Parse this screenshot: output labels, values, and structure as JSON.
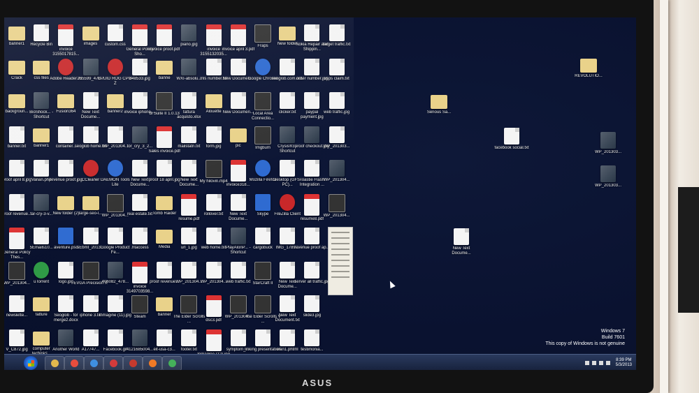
{
  "desktop": {
    "icons": [
      {
        "label": "banner1",
        "kind": "folder"
      },
      {
        "label": "Recycle Bin",
        "kind": "doc"
      },
      {
        "label": "invoice 3155017815...",
        "kind": "pdf"
      },
      {
        "label": "images",
        "kind": "folder"
      },
      {
        "label": "custom.css",
        "kind": "doc"
      },
      {
        "label": "General Policy Sho...",
        "kind": "pdf"
      },
      {
        "label": "invoice proof.pdf",
        "kind": "pdf"
      },
      {
        "label": "piano.jpg",
        "kind": "img"
      },
      {
        "label": "invoice 3155132035...",
        "kind": "pdf"
      },
      {
        "label": "invoice april 3.pdf",
        "kind": "pdf"
      },
      {
        "label": "Fraps",
        "kind": "dark"
      },
      {
        "label": "New folder",
        "kind": "folder"
      },
      {
        "label": "Nokia Repair and Shippin...",
        "kind": "doc"
      },
      {
        "label": "target traffic.txt",
        "kind": "doc"
      },
      {
        "label": "Crack",
        "kind": "folder"
      },
      {
        "label": "css files",
        "kind": "folder"
      },
      {
        "label": "Adobe Reader XI",
        "kind": "red"
      },
      {
        "label": "255599_478...",
        "kind": "img"
      },
      {
        "label": "CPUID ROG CPU-Z",
        "kind": "red"
      },
      {
        "label": "848533.jpg",
        "kind": "doc"
      },
      {
        "label": "banne",
        "kind": "folder"
      },
      {
        "label": "WXI-absolu...",
        "kind": "img"
      },
      {
        "label": "mls number.txt",
        "kind": "doc"
      },
      {
        "label": "New Documen...",
        "kind": "doc"
      },
      {
        "label": "Google Chrome",
        "kind": "round"
      },
      {
        "label": "seoglob.com.odv",
        "kind": "doc"
      },
      {
        "label": "order number.jpg",
        "kind": "doc"
      },
      {
        "label": "usps claim.txt",
        "kind": "doc"
      },
      {
        "label": "backgroun...",
        "kind": "folder"
      },
      {
        "label": "BioShock... - Shortcut",
        "kind": "img"
      },
      {
        "label": "Fusion364",
        "kind": "folder"
      },
      {
        "label": "New Text Docume...",
        "kind": "doc"
      },
      {
        "label": "banner2",
        "kind": "folder"
      },
      {
        "label": "invoice iphone ...",
        "kind": "doc"
      },
      {
        "label": "dl Suite II 1.0.13",
        "kind": "dark"
      },
      {
        "label": "fattura acquisto.xlsx",
        "kind": "doc"
      },
      {
        "label": "Alouette",
        "kind": "folder"
      },
      {
        "label": "New Documen...",
        "kind": "doc"
      },
      {
        "label": "Local Area Connectio...",
        "kind": "dark"
      },
      {
        "label": "clicker.txt",
        "kind": "doc"
      },
      {
        "label": "paypal payment.jpg",
        "kind": "doc"
      },
      {
        "label": "web traffic.jpg",
        "kind": "doc"
      },
      {
        "label": "banner.txt",
        "kind": "doc"
      },
      {
        "label": "banner1",
        "kind": "folder"
      },
      {
        "label": "container...",
        "kind": "doc"
      },
      {
        "label": "seoglob home.txt",
        "kind": "doc"
      },
      {
        "label": "WP_201304...",
        "kind": "doc"
      },
      {
        "label": "for_cry_3_2...",
        "kind": "img"
      },
      {
        "label": "Sales invoice.pdf",
        "kind": "pdf"
      },
      {
        "label": "mailstatri.txt",
        "kind": "doc"
      },
      {
        "label": "form.jpg",
        "kind": "doc"
      },
      {
        "label": "pic",
        "kind": "folder"
      },
      {
        "label": "Imgbum",
        "kind": "dark"
      },
      {
        "label": "Crysis®3 - Shortcut",
        "kind": "img"
      },
      {
        "label": "proof checkout.jpg",
        "kind": "img"
      },
      {
        "label": "WP_201303...",
        "kind": "doc"
      },
      {
        "label": "proof april 8.jpg",
        "kind": "doc"
      },
      {
        "label": "Varian.php",
        "kind": "doc"
      },
      {
        "label": "revenue proof.jpg",
        "kind": "doc"
      },
      {
        "label": "CCleaner",
        "kind": "red"
      },
      {
        "label": "DAEMON Tools Lite",
        "kind": "round"
      },
      {
        "label": "New Text Docume...",
        "kind": "doc"
      },
      {
        "label": "proof 18 april.jpg",
        "kind": "doc"
      },
      {
        "label": "New Text Docume...",
        "kind": "doc"
      },
      {
        "label": "My hilovin.mp4",
        "kind": "dark"
      },
      {
        "label": "invoice318...",
        "kind": "pdf"
      },
      {
        "label": "Mozilla Firefox",
        "kind": "round"
      },
      {
        "label": "Desktop (GFS-PC)...",
        "kind": "doc"
      },
      {
        "label": "Toastie Flash Integration ...",
        "kind": "doc"
      },
      {
        "label": "WP_201304...",
        "kind": "img"
      },
      {
        "label": "proof revenue...",
        "kind": "doc"
      },
      {
        "label": "far-cry-3-v...",
        "kind": "img"
      },
      {
        "label": "New folder (2)",
        "kind": "folder"
      },
      {
        "label": "large-seo-l...",
        "kind": "folder"
      },
      {
        "label": "WP_201304...",
        "kind": "dark"
      },
      {
        "label": "real estate.txt",
        "kind": "doc"
      },
      {
        "label": "Tomb Raider",
        "kind": "folder"
      },
      {
        "label": "resume.pdf",
        "kind": "pdf"
      },
      {
        "label": "rollover.txt",
        "kind": "doc"
      },
      {
        "label": "New Text Docume...",
        "kind": "doc"
      },
      {
        "label": "Skype",
        "kind": "blue"
      },
      {
        "label": "FileZilla Client",
        "kind": "red"
      },
      {
        "label": "resume8.pdf",
        "kind": "pdf"
      },
      {
        "label": "WP_201304...",
        "kind": "dark"
      },
      {
        "label": "General Policy Thes...",
        "kind": "pdf"
      },
      {
        "label": "5Emails10...",
        "kind": "doc"
      },
      {
        "label": "aventure.psd",
        "kind": "blue"
      },
      {
        "label": "sEbmt_2013...",
        "kind": "doc"
      },
      {
        "label": "Google Product Fe...",
        "kind": "doc"
      },
      {
        "label": ".htaccess",
        "kind": "doc"
      },
      {
        "label": "Media",
        "kind": "folder"
      },
      {
        "label": "url_1.jpg",
        "kind": "doc"
      },
      {
        "label": "web home.txt",
        "kind": "doc"
      },
      {
        "label": "PlayAlonP... - Shortcut",
        "kind": "img"
      },
      {
        "label": "cargobuck",
        "kind": "doc"
      },
      {
        "label": "IMG_1789...",
        "kind": "doc"
      },
      {
        "label": "revenue proof ap...",
        "kind": "doc"
      },
      {
        "label": "",
        "kind": "none"
      },
      {
        "label": "WP_201304...",
        "kind": "dark"
      },
      {
        "label": "uTorrent",
        "kind": "green"
      },
      {
        "label": "logo.jpg",
        "kind": "doc"
      },
      {
        "label": "EVGA Precision X",
        "kind": "dark"
      },
      {
        "label": "406082_478...",
        "kind": "img"
      },
      {
        "label": "invoice 3149703598...",
        "kind": "pdf"
      },
      {
        "label": "proof revenue...",
        "kind": "doc"
      },
      {
        "label": "WP_201304...",
        "kind": "doc"
      },
      {
        "label": "WP_201304...",
        "kind": "doc"
      },
      {
        "label": "web traffic.txt",
        "kind": "doc"
      },
      {
        "label": "StarCraft II",
        "kind": "dark"
      },
      {
        "label": "New Text Docume...",
        "kind": "doc"
      },
      {
        "label": "server all traffic.jpg",
        "kind": "doc"
      },
      {
        "label": "",
        "kind": "none"
      },
      {
        "label": "newslette...",
        "kind": "doc"
      },
      {
        "label": "fatture",
        "kind": "folder"
      },
      {
        "label": "Seoglob - for merge2.docx",
        "kind": "doc"
      },
      {
        "label": "iphone 3.txt",
        "kind": "doc"
      },
      {
        "label": "Inmagine (11).jpg",
        "kind": "doc"
      },
      {
        "label": "Steam",
        "kind": "dark"
      },
      {
        "label": "banner",
        "kind": "folder"
      },
      {
        "label": "The Elder Scrolls ...",
        "kind": "dark"
      },
      {
        "label": "dsc3.pdf",
        "kind": "pdf"
      },
      {
        "label": "WP_201304...",
        "kind": "dark"
      },
      {
        "label": "The Elder Scrolls V ...",
        "kind": "dark"
      },
      {
        "label": "New Text Document.txt",
        "kind": "doc"
      },
      {
        "label": "slide3.jpg",
        "kind": "doc"
      },
      {
        "label": "",
        "kind": "none"
      },
      {
        "label": "V_C872.jpg",
        "kind": "doc"
      },
      {
        "label": "computer techinici...",
        "kind": "folder"
      },
      {
        "label": "Another World",
        "kind": "img"
      },
      {
        "label": "A17747...",
        "kind": "doc"
      },
      {
        "label": "Facebook.gif",
        "kind": "doc"
      },
      {
        "label": "4121685004...",
        "kind": "img"
      },
      {
        "label": "eit-usa-c3...",
        "kind": "doc"
      },
      {
        "label": "footer.txt",
        "kind": "doc"
      },
      {
        "label": "Inmagine (12).jpg",
        "kind": "pdf"
      },
      {
        "label": "symptom_l...",
        "kind": "doc"
      },
      {
        "label": "linking presentation",
        "kind": "doc"
      },
      {
        "label": "wan1.phtml",
        "kind": "doc"
      },
      {
        "label": "testimonia...",
        "kind": "doc"
      },
      {
        "label": "",
        "kind": "none"
      }
    ],
    "right_icons": [
      {
        "label": "REVOLUTIO...",
        "kind": "folder"
      },
      {
        "label": "Serious Sa...",
        "kind": "folder"
      },
      {
        "label": "facebook social.txt",
        "kind": "doc"
      },
      {
        "label": "WP_201303...",
        "kind": "img"
      },
      {
        "label": "WP_201303...",
        "kind": "img"
      },
      {
        "label": "New Text Docume...",
        "kind": "doc"
      }
    ]
  },
  "watermark": {
    "line1": "Windows 7",
    "line2": "Build 7601",
    "line3": "This copy of Windows is not genuine"
  },
  "taskbar": {
    "pinned": [
      {
        "name": "windows-explorer",
        "color": "#e2b84d"
      },
      {
        "name": "chrome",
        "color": "#e84d3d"
      },
      {
        "name": "internet-explorer",
        "color": "#3f8fe0"
      },
      {
        "name": "app-red-1",
        "color": "#d43b3b"
      },
      {
        "name": "app-red-2",
        "color": "#c53a2e"
      },
      {
        "name": "firefox",
        "color": "#f07a26"
      },
      {
        "name": "app-green",
        "color": "#45b05a"
      }
    ],
    "clock_time": "8:39 PM",
    "clock_date": "5/3/2013"
  },
  "brand": "ASUS",
  "colors": {
    "desktop": "#0a1230",
    "taskbar": "#1c2946"
  }
}
